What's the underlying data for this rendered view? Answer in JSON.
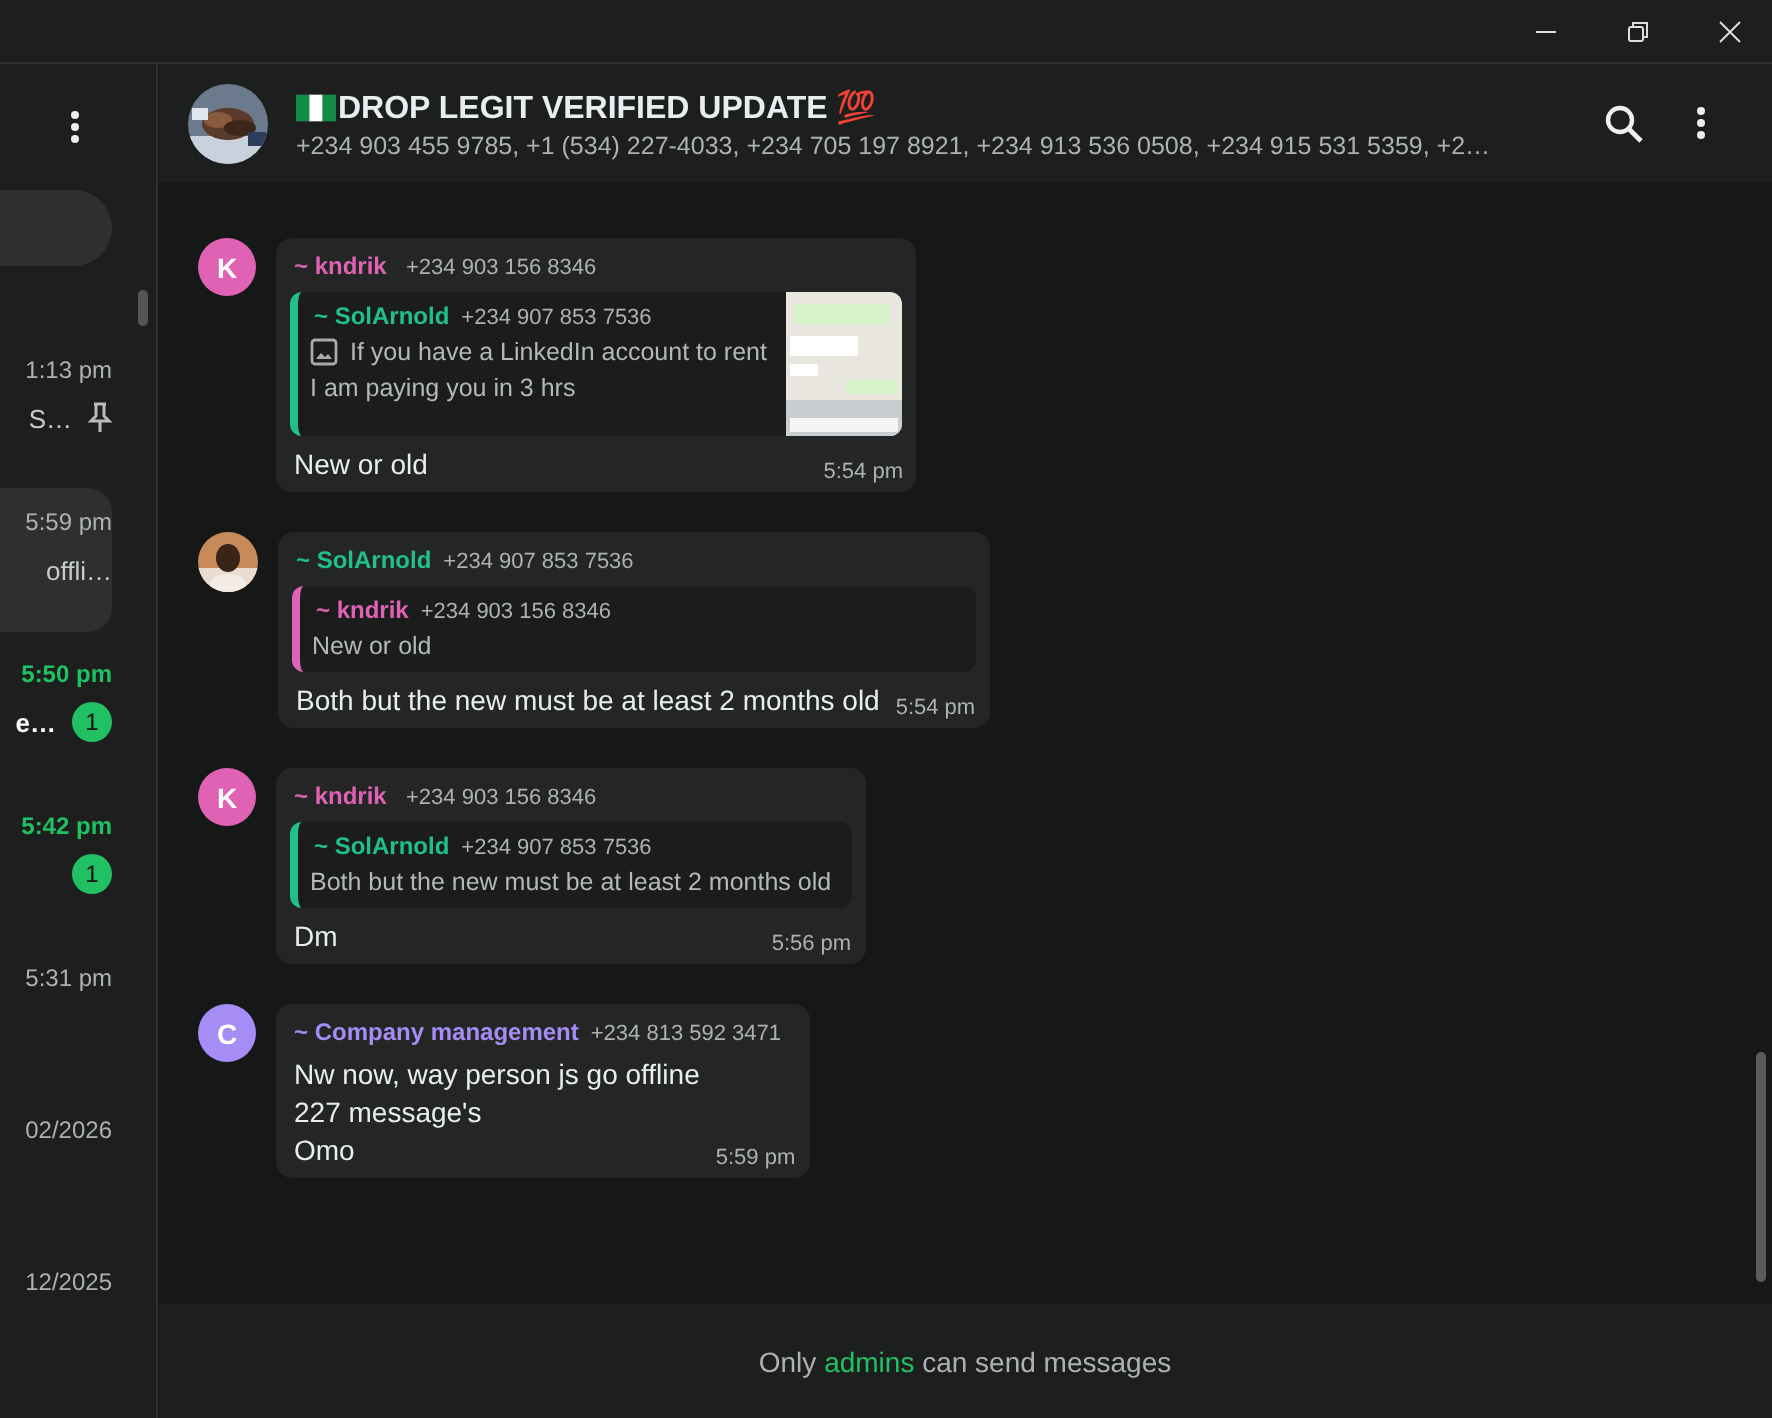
{
  "sidebar": {
    "items": [
      {
        "time": "1:13 pm",
        "preview": "S…",
        "pinned": true,
        "unread": false,
        "selected": false
      },
      {
        "time": "5:59 pm",
        "preview": "offli…",
        "pinned": false,
        "unread": false,
        "selected": true
      },
      {
        "time": "5:50 pm",
        "preview": "e…",
        "pinned": false,
        "unread": true,
        "selected": false,
        "badge": "1"
      },
      {
        "time": "5:42 pm",
        "pinned": false,
        "unread": true,
        "selected": false,
        "badge": "1"
      },
      {
        "time": "5:31 pm",
        "pinned": false,
        "unread": false,
        "selected": false
      },
      {
        "time": "02/2026",
        "pinned": false,
        "unread": false,
        "selected": false
      },
      {
        "time": "12/2025",
        "pinned": false,
        "unread": false,
        "selected": false
      }
    ]
  },
  "chat": {
    "title": "DROP LEGIT VERIFIED UPDATE 💯",
    "members": "+234 903 455 9785, +1 (534) 227-4033, +234 705 197 8921, +234 913 536 0508, +234 915 531 5359, +2…"
  },
  "messages": [
    {
      "avatar": {
        "kind": "letter",
        "letter": "K",
        "color": "#e062b4"
      },
      "sender": "~ kndrik",
      "color": "#e062b4",
      "phone": "+234 903 156 8346",
      "quote": {
        "sender": "~ SolArnold",
        "color": "#21c08b",
        "phone": "+234 907 853 7536",
        "lines": [
          "If you have a LinkedIn account to rent",
          "I am paying you in 3 hrs"
        ],
        "image": true
      },
      "body": [
        "New or old"
      ],
      "time": "5:54 pm"
    },
    {
      "avatar": {
        "kind": "picture"
      },
      "sender": "~ SolArnold",
      "color": "#21c08b",
      "phone": "+234 907 853 7536",
      "quote": {
        "sender": "~ kndrik",
        "color": "#e062b4",
        "phone": "+234 903 156 8346",
        "lines": [
          "New or old"
        ],
        "image": false
      },
      "body": [
        "Both but the new must be at least 2 months old"
      ],
      "time": "5:54 pm"
    },
    {
      "avatar": {
        "kind": "letter",
        "letter": "K",
        "color": "#e062b4"
      },
      "sender": "~ kndrik",
      "color": "#e062b4",
      "phone": "+234 903 156 8346",
      "quote": {
        "sender": "~ SolArnold",
        "color": "#21c08b",
        "phone": "+234 907 853 7536",
        "lines": [
          "Both but the new must be at least 2 months old"
        ],
        "image": false
      },
      "body": [
        "Dm"
      ],
      "time": "5:56 pm"
    },
    {
      "avatar": {
        "kind": "letter",
        "letter": "C",
        "color": "#a68cf5"
      },
      "sender": "~ Company management",
      "color": "#a68cf5",
      "phone": "+234 813 592 3471",
      "body": [
        "Nw now, way person js go offline",
        "227 message's",
        "Omo"
      ],
      "time": "5:59 pm"
    }
  ],
  "footer": {
    "before": "Only",
    "link": "admins",
    "after": "can send messages"
  }
}
